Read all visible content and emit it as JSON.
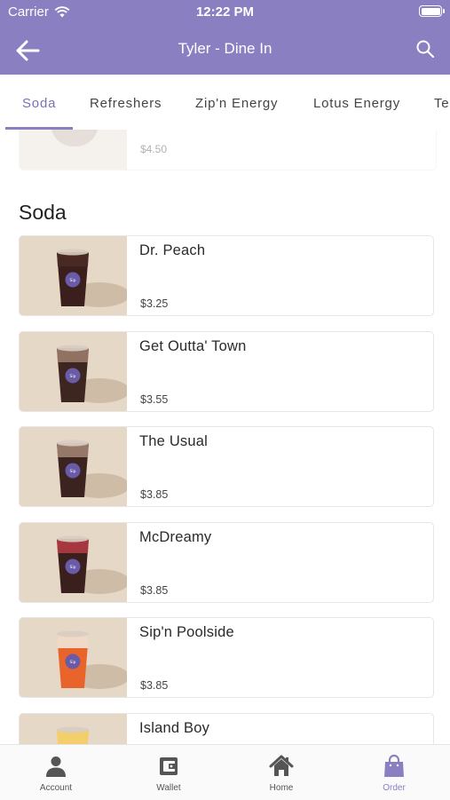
{
  "status": {
    "carrier": "Carrier",
    "time": "12:22 PM"
  },
  "header": {
    "title": "Tyler - Dine In"
  },
  "tabs": [
    {
      "label": "Soda",
      "active": true
    },
    {
      "label": "Refreshers",
      "active": false
    },
    {
      "label": "Zip'n Energy",
      "active": false
    },
    {
      "label": "Lotus Energy",
      "active": false
    },
    {
      "label": "Te",
      "active": false
    }
  ],
  "previous_item": {
    "price": "$4.50"
  },
  "section": {
    "title": "Soda"
  },
  "items": [
    {
      "name": "Dr. Peach",
      "price": "$3.25",
      "drink_color": "#3a1f1c",
      "top_color": "#4a2a25"
    },
    {
      "name": "Get Outta' Town",
      "price": "$3.55",
      "drink_color": "#3d2520",
      "top_color": "#9a7a68"
    },
    {
      "name": "The Usual",
      "price": "$3.85",
      "drink_color": "#3b231f",
      "top_color": "#a08270"
    },
    {
      "name": "McDreamy",
      "price": "$3.85",
      "drink_color": "#3a201d",
      "top_color": "#b23a44"
    },
    {
      "name": "Sip'n Poolside",
      "price": "$3.85",
      "drink_color": "#e8642a",
      "top_color": "#f1e6d8"
    },
    {
      "name": "Island Boy",
      "price": "",
      "drink_color": "#f0b23a",
      "top_color": "#f3d070"
    }
  ],
  "bottom_nav": [
    {
      "label": "Account",
      "icon": "person-icon",
      "active": false
    },
    {
      "label": "Wallet",
      "icon": "wallet-icon",
      "active": false
    },
    {
      "label": "Home",
      "icon": "home-icon",
      "active": false
    },
    {
      "label": "Order",
      "icon": "shopping-bag-icon",
      "active": true
    }
  ],
  "colors": {
    "brand": "#8a80c1",
    "active_text": "#7a6fb8"
  }
}
